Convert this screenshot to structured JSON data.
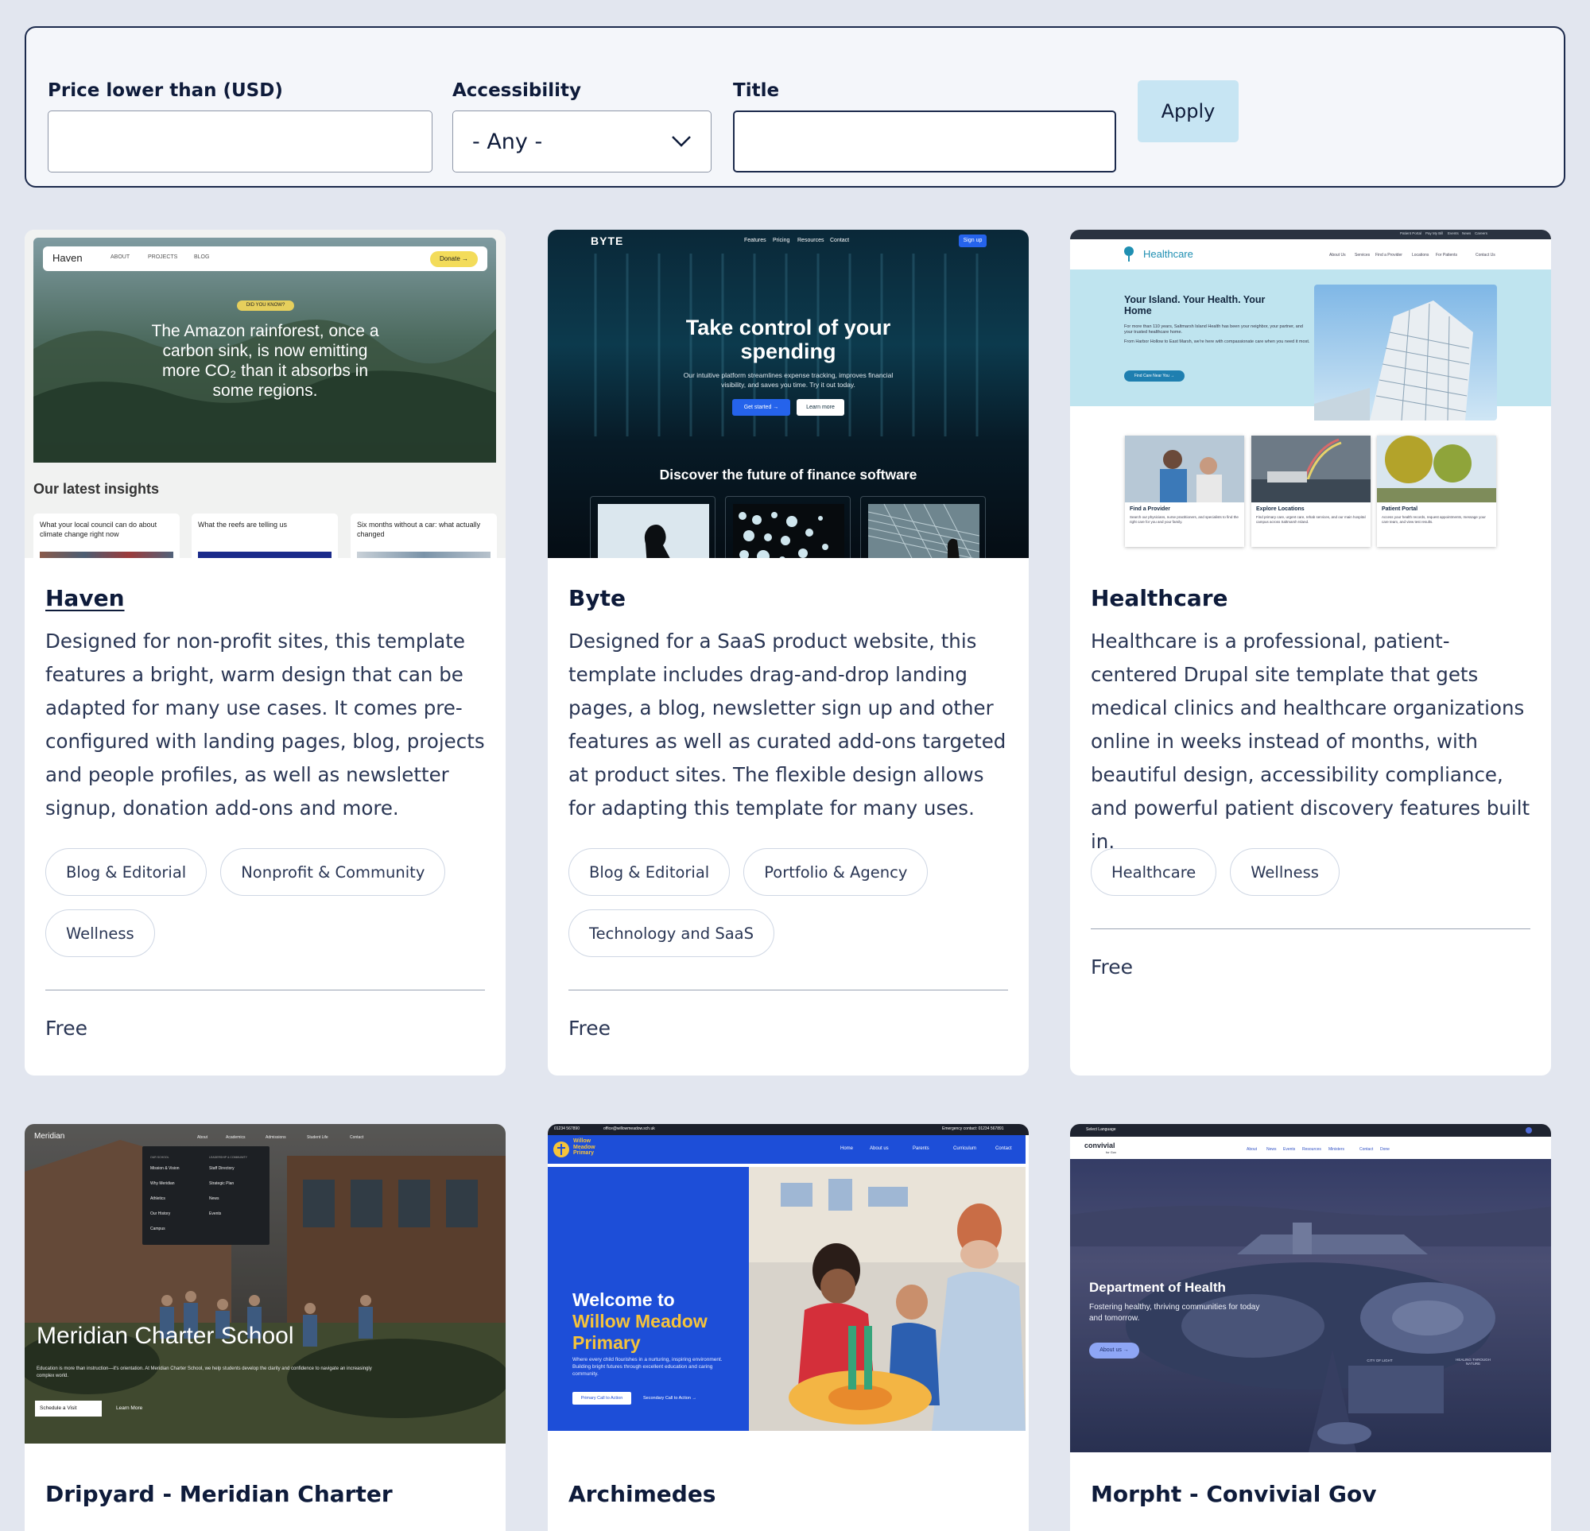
{
  "filters": {
    "price_label": "Price lower than (USD)",
    "price_value": "",
    "accessibility_label": "Accessibility",
    "accessibility_value": "- Any -",
    "title_label": "Title",
    "title_value": "",
    "apply_label": "Apply"
  },
  "cards": [
    {
      "title": "Haven",
      "description": "Designed for non-profit sites, this template features a bright, warm design that can be adapted for many use cases. It comes pre-configured with landing pages, blog, projects and people profiles, as well as newsletter signup, donation add-ons and more.",
      "tags": [
        "Blog & Editorial",
        "Nonprofit & Community",
        "Wellness"
      ],
      "price": "Free",
      "shot": {
        "logo": "Haven",
        "nav": [
          "ABOUT",
          "PROJECTS",
          "BLOG"
        ],
        "cta": "Donate →",
        "badge": "DID YOU KNOW?",
        "hero_line1": "The Amazon rainforest, once a",
        "hero_line2": "carbon sink, is now emitting",
        "hero_line3": "more CO₂ than it absorbs in",
        "hero_line4": "some regions.",
        "section": "Our latest insights",
        "posts": [
          "What your local council can do about climate change right now",
          "What the reefs are telling us",
          "Six months without a car: what actually changed"
        ]
      }
    },
    {
      "title": "Byte",
      "description": "Designed for a SaaS product website, this template includes drag-and-drop landing pages, a blog, newsletter sign up and other features as well as curated add-ons targeted at product sites. The flexible design allows for adapting this template for many uses.",
      "tags": [
        "Blog & Editorial",
        "Portfolio & Agency",
        "Technology and SaaS"
      ],
      "price": "Free",
      "shot": {
        "logo": "BYTE",
        "nav": [
          "Features",
          "Pricing",
          "Resources",
          "Contact"
        ],
        "cta": "Sign up",
        "hero_line1": "Take control of your",
        "hero_line2": "spending",
        "sub_line1": "Our intuitive platform streamlines expense tracking, improves financial",
        "sub_line2": "visibility, and saves you time. Try it out today.",
        "btn1": "Get started →",
        "btn2": "Learn more",
        "section": "Discover the future of finance software"
      }
    },
    {
      "title": "Healthcare",
      "description": "Healthcare is a professional, patient-centered Drupal site template that gets medical clinics and healthcare organizations online in weeks instead of months, with beautiful design, accessibility compliance, and powerful patient discovery features built in.",
      "tags": [
        "Healthcare",
        "Wellness"
      ],
      "price": "Free",
      "shot": {
        "logo": "Healthcare",
        "top_links": [
          "Patient Portal",
          "Pay My Bill",
          "Events",
          "News",
          "Careers"
        ],
        "nav": [
          "About Us",
          "Services",
          "Find a Provider",
          "Locations",
          "For Patients",
          "Contact Us"
        ],
        "hero_line1": "Your Island. Your Health. Your",
        "hero_line2": "Home",
        "hero_p1": "For more than 110 years, Saltmarsh Island Health has been your neighbor, your partner, and your trusted healthcare home.",
        "hero_p2": "From Harbor Hollow to East Marsh, we're here with compassionate care when you need it most.",
        "hero_btn": "Find Care Near You →",
        "tiles": [
          {
            "title": "Find a Provider",
            "text": "Search our physicians, nurse practitioners, and specialists to find the right care for you and your family."
          },
          {
            "title": "Explore Locations",
            "text": "Find primary care, urgent care, rehab services, and our main hospital campus across Saltmarsh Island."
          },
          {
            "title": "Patient Portal",
            "text": "Access your health records, request appointments, message your care team, and view test results."
          }
        ]
      }
    },
    {
      "title": "Dripyard - Meridian Charter",
      "shot": {
        "logo": "Meridian",
        "nav": [
          "About",
          "Academics",
          "Admissions",
          "Student Life",
          "Contact"
        ],
        "menu_col1_head": "OUR SCHOOL",
        "menu_col1": [
          "Mission & Vision",
          "Why Meridian",
          "Athletics",
          "Our History",
          "Campus"
        ],
        "menu_col2_head": "LEADERSHIP & COMMUNITY",
        "menu_col2": [
          "Staff Directory",
          "Strategic Plan",
          "News",
          "Events"
        ],
        "hero": "Meridian Charter School",
        "hero_p": "Education is more than instruction—it's orientation. At Meridian Charter School, we help students develop the clarity and confidence to navigate an increasingly complex world.",
        "btn1": "Schedule a Visit",
        "btn2": "Learn More"
      }
    },
    {
      "title": "Archimedes",
      "shot": {
        "phone": "01234 567890",
        "email": "office@willowmeadow.sch.uk",
        "emergency": "Emergency contact: 01234 567891",
        "logo_line1": "Willow",
        "logo_line2": "Meadow",
        "logo_line3": "Primary",
        "nav": [
          "Home",
          "About us",
          "Parents",
          "Curriculum",
          "Contact"
        ],
        "hero_line1": "Welcome to",
        "hero_line2": "Willow Meadow",
        "hero_line3": "Primary",
        "hero_p": "Where every child flourishes in a nurturing, inspiring environment. Building bright futures through excellent education and caring community.",
        "btn1": "Primary Call to Action",
        "btn2": "Secondary Call to Action →"
      }
    },
    {
      "title": "Morpht - Convivial Gov",
      "shot": {
        "lang": "Select Language",
        "logo": "convivial",
        "logo_sub": "for Gov",
        "nav": [
          "About",
          "News",
          "Events",
          "Resources",
          "Ministers",
          "Contact",
          "Done"
        ],
        "hero": "Department of Health",
        "hero_p1": "Fostering healthy, thriving communities for today",
        "hero_p2": "and tomorrow.",
        "btn": "About us →",
        "sign1": "CITY OF LIGHT",
        "sign2": "HEALING THROUGH NATURE"
      }
    }
  ]
}
